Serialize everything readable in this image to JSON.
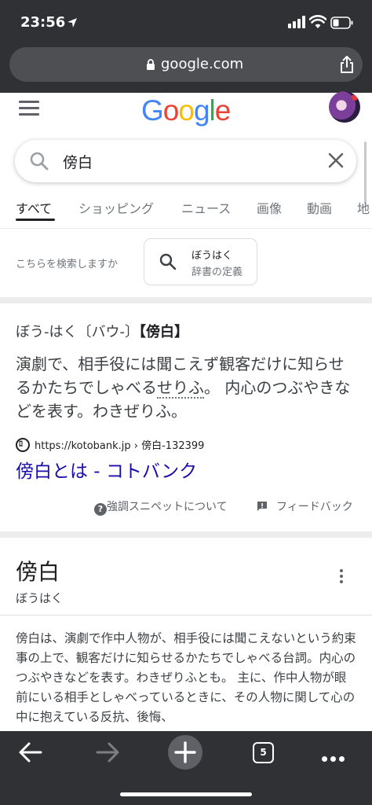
{
  "status_bar": {
    "time": "23:56"
  },
  "address_bar": {
    "url": "google.com"
  },
  "google": {
    "logo_letters": [
      {
        "char": "G",
        "color": "#4285F4"
      },
      {
        "char": "o",
        "color": "#EA4335"
      },
      {
        "char": "o",
        "color": "#FBBC05"
      },
      {
        "char": "g",
        "color": "#4285F4"
      },
      {
        "char": "l",
        "color": "#34A853"
      },
      {
        "char": "e",
        "color": "#EA4335"
      }
    ]
  },
  "search": {
    "query": "傍白"
  },
  "tabs": [
    {
      "label": "すべて",
      "active": true
    },
    {
      "label": "ショッピング",
      "active": false
    },
    {
      "label": "ニュース",
      "active": false
    },
    {
      "label": "画像",
      "active": false
    },
    {
      "label": "動画",
      "active": false
    },
    {
      "label": "地",
      "active": false
    }
  ],
  "suggestion": {
    "label": "こちらを検索しますか",
    "chip_top": "ぼうはく",
    "chip_bottom": "辞書の定義"
  },
  "snippet": {
    "heading_plain": "ぼう‐はく〔バウ‐〕",
    "heading_bold": "【傍白】",
    "body_1": "演劇で、相手役には聞こえず観客だけに知らせるかたちでしゃべる",
    "body_dotted": "せりふ",
    "body_2": "。 内心のつぶやきなどを表す。わきぜりふ。",
    "source_url": "https://kotobank.jp › 傍白-132399",
    "link_title": "傍白とは - コトバンク",
    "about_label": "強調スニペットについて",
    "feedback_label": "フィードバック"
  },
  "knowledge_panel": {
    "title": "傍白",
    "reading": "ぼうはく",
    "description": "傍白は、演劇で作中人物が、相手役には聞こえないという約束事の上で、観客だけに知らせるかたちでしゃべる台詞。内心のつぶやきなどを表す。わきぜりふとも。 主に、作中人物が眼前にいる相手としゃべっているときに、その人物に関して心の中に抱えている反抗、後悔、"
  },
  "toolbar": {
    "tab_count": "5"
  },
  "colors": {
    "chrome": "#303134",
    "link": "#1a0dab",
    "text": "#202124"
  }
}
